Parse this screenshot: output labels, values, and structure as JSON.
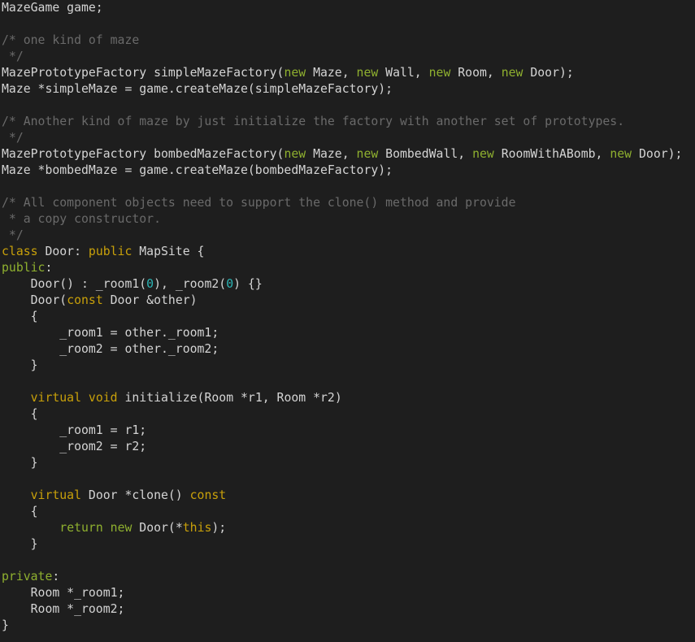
{
  "colors": {
    "background": "#1e1e1e",
    "plain": "#d4d4d4",
    "comment": "#6a6a6a",
    "keyword": "#c8a00a",
    "new": "#8fb02f",
    "number": "#2bb5b5"
  },
  "code": [
    [
      {
        "c": "plain",
        "t": "MazeGame game;"
      }
    ],
    [],
    [
      {
        "c": "comment",
        "t": "/* one kind of maze"
      }
    ],
    [
      {
        "c": "comment",
        "t": " */"
      }
    ],
    [
      {
        "c": "plain",
        "t": "MazePrototypeFactory simpleMazeFactory("
      },
      {
        "c": "new",
        "t": "new"
      },
      {
        "c": "plain",
        "t": " Maze, "
      },
      {
        "c": "new",
        "t": "new"
      },
      {
        "c": "plain",
        "t": " Wall, "
      },
      {
        "c": "new",
        "t": "new"
      },
      {
        "c": "plain",
        "t": " Room, "
      },
      {
        "c": "new",
        "t": "new"
      },
      {
        "c": "plain",
        "t": " Door);"
      }
    ],
    [
      {
        "c": "plain",
        "t": "Maze *simpleMaze = game.createMaze(simpleMazeFactory);"
      }
    ],
    [],
    [
      {
        "c": "comment",
        "t": "/* Another kind of maze by just initialize the factory with another set of prototypes."
      }
    ],
    [
      {
        "c": "comment",
        "t": " */"
      }
    ],
    [
      {
        "c": "plain",
        "t": "MazePrototypeFactory bombedMazeFactory("
      },
      {
        "c": "new",
        "t": "new"
      },
      {
        "c": "plain",
        "t": " Maze, "
      },
      {
        "c": "new",
        "t": "new"
      },
      {
        "c": "plain",
        "t": " BombedWall, "
      },
      {
        "c": "new",
        "t": "new"
      },
      {
        "c": "plain",
        "t": " RoomWithABomb, "
      },
      {
        "c": "new",
        "t": "new"
      },
      {
        "c": "plain",
        "t": " Door);"
      }
    ],
    [
      {
        "c": "plain",
        "t": "Maze *bombedMaze = game.createMaze(bombedMazeFactory);"
      }
    ],
    [],
    [
      {
        "c": "comment",
        "t": "/* All component objects need to support the clone() method and provide"
      }
    ],
    [
      {
        "c": "comment",
        "t": " * a copy constructor."
      }
    ],
    [
      {
        "c": "comment",
        "t": " */"
      }
    ],
    [
      {
        "c": "keyword",
        "t": "class"
      },
      {
        "c": "plain",
        "t": " Door: "
      },
      {
        "c": "keyword",
        "t": "public"
      },
      {
        "c": "plain",
        "t": " MapSite {"
      }
    ],
    [
      {
        "c": "new",
        "t": "public"
      },
      {
        "c": "plain",
        "t": ":"
      }
    ],
    [
      {
        "c": "plain",
        "t": "    Door() : _room1("
      },
      {
        "c": "number",
        "t": "0"
      },
      {
        "c": "plain",
        "t": "), _room2("
      },
      {
        "c": "number",
        "t": "0"
      },
      {
        "c": "plain",
        "t": ") {}"
      }
    ],
    [
      {
        "c": "plain",
        "t": "    Door("
      },
      {
        "c": "keyword",
        "t": "const"
      },
      {
        "c": "plain",
        "t": " Door &other)"
      }
    ],
    [
      {
        "c": "plain",
        "t": "    {"
      }
    ],
    [
      {
        "c": "plain",
        "t": "        _room1 = other._room1;"
      }
    ],
    [
      {
        "c": "plain",
        "t": "        _room2 = other._room2;"
      }
    ],
    [
      {
        "c": "plain",
        "t": "    }"
      }
    ],
    [],
    [
      {
        "c": "plain",
        "t": "    "
      },
      {
        "c": "keyword",
        "t": "virtual"
      },
      {
        "c": "plain",
        "t": " "
      },
      {
        "c": "keyword",
        "t": "void"
      },
      {
        "c": "plain",
        "t": " initialize(Room *r1, Room *r2)"
      }
    ],
    [
      {
        "c": "plain",
        "t": "    {"
      }
    ],
    [
      {
        "c": "plain",
        "t": "        _room1 = r1;"
      }
    ],
    [
      {
        "c": "plain",
        "t": "        _room2 = r2;"
      }
    ],
    [
      {
        "c": "plain",
        "t": "    }"
      }
    ],
    [],
    [
      {
        "c": "plain",
        "t": "    "
      },
      {
        "c": "keyword",
        "t": "virtual"
      },
      {
        "c": "plain",
        "t": " Door *clone() "
      },
      {
        "c": "keyword",
        "t": "const"
      }
    ],
    [
      {
        "c": "plain",
        "t": "    {"
      }
    ],
    [
      {
        "c": "plain",
        "t": "        "
      },
      {
        "c": "new",
        "t": "return"
      },
      {
        "c": "plain",
        "t": " "
      },
      {
        "c": "new",
        "t": "new"
      },
      {
        "c": "plain",
        "t": " Door(*"
      },
      {
        "c": "keyword",
        "t": "this"
      },
      {
        "c": "plain",
        "t": ");"
      }
    ],
    [
      {
        "c": "plain",
        "t": "    }"
      }
    ],
    [],
    [
      {
        "c": "new",
        "t": "private"
      },
      {
        "c": "plain",
        "t": ":"
      }
    ],
    [
      {
        "c": "plain",
        "t": "    Room *_room1;"
      }
    ],
    [
      {
        "c": "plain",
        "t": "    Room *_room2;"
      }
    ],
    [
      {
        "c": "plain",
        "t": "}"
      }
    ]
  ]
}
